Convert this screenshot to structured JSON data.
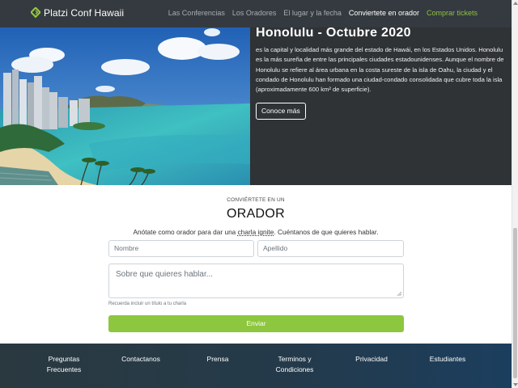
{
  "navbar": {
    "brand": "Platzi Conf Hawaii",
    "links": [
      {
        "label": "Las Conferencias",
        "state": "default"
      },
      {
        "label": "Los Oradores",
        "state": "default"
      },
      {
        "label": "El lugar y la fecha",
        "state": "default"
      },
      {
        "label": "Conviertete en orador",
        "state": "active"
      },
      {
        "label": "Comprar tickets",
        "state": "highlight"
      }
    ],
    "colors": {
      "background": "#343a40",
      "highlight": "#8fc043"
    }
  },
  "hero": {
    "title": "Honolulu - Octubre 2020",
    "description": "es la capital y localidad más grande del estado de Hawái, en los Estados Unidos. Honolulu es la más sureña de entre las principales ciudades estadounidenses. Aunque el nombre de Honolulu se refiere al área urbana en la costa sureste de la isla de Oahu, la ciudad y el condado de Honolulu han formado una ciudad-condado consolidada que cubre toda la isla (aproximadamente 600 km² de superficie).",
    "button_label": "Conoce más",
    "image": "honolulu-beach-photo"
  },
  "speaker_form": {
    "kicker": "CONVIÉRTETE EN UN",
    "title": "ORADOR",
    "subtitle_pre": "Anótate como orador para dar una ",
    "subtitle_link": "charla ignite",
    "subtitle_post": ". Cuéntanos de que quieres hablar.",
    "first_name_placeholder": "Nombre",
    "last_name_placeholder": "Apellido",
    "topic_placeholder": "Sobre que quieres hablar...",
    "hint": "Recuerda incluir un título a tu charla",
    "submit_label": "Enviar",
    "submit_color": "#8dc63f"
  },
  "footer": {
    "items": [
      {
        "line1": "Preguntas Frecuentes",
        "line2": ""
      },
      {
        "line1": "Contactanos",
        "line2": ""
      },
      {
        "line1": "Prensa",
        "line2": ""
      },
      {
        "line1": "Terminos y",
        "line2": "Condiciones"
      },
      {
        "line1": "Privacidad",
        "line2": ""
      },
      {
        "line1": "Estudiantes",
        "line2": ""
      }
    ]
  },
  "scroll": {
    "position": 0.62
  }
}
